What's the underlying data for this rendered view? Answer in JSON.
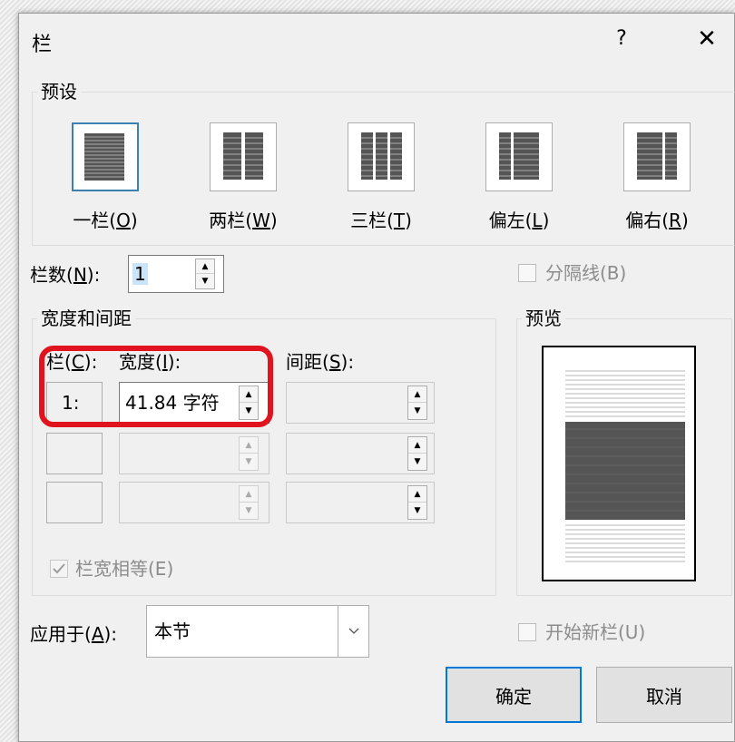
{
  "dialog": {
    "title": "栏",
    "help_label": "?",
    "close_label": "✕"
  },
  "presets": {
    "group_label": "预设",
    "items": [
      {
        "text": "一栏(",
        "key": "O",
        "end": ")",
        "icon": "one-column-icon"
      },
      {
        "text": "两栏(",
        "key": "W",
        "end": ")",
        "icon": "two-columns-icon"
      },
      {
        "text": "三栏(",
        "key": "T",
        "end": ")",
        "icon": "three-columns-icon"
      },
      {
        "text": "偏左(",
        "key": "L",
        "end": ")",
        "icon": "left-column-icon"
      },
      {
        "text": "偏右(",
        "key": "R",
        "end": ")",
        "icon": "right-column-icon"
      }
    ],
    "selected_index": 0
  },
  "column_count": {
    "label_text": "栏数(",
    "label_key": "N",
    "label_end": "):",
    "value": "1"
  },
  "separator": {
    "label": "分隔线(B)",
    "checked": false
  },
  "width_spacing": {
    "group_label": "宽度和间距",
    "col_header_text": "栏(",
    "col_header_key": "C",
    "col_header_end": "):",
    "width_header_text": "宽度(",
    "width_header_key": "I",
    "width_header_end": "):",
    "spacing_header_text": "间距(",
    "spacing_header_key": "S",
    "spacing_header_end": "):",
    "rows": [
      {
        "col": "1:",
        "width": "41.84 字符",
        "spacing": ""
      },
      {
        "col": "",
        "width": "",
        "spacing": ""
      },
      {
        "col": "",
        "width": "",
        "spacing": ""
      }
    ],
    "equal_width_label": "栏宽相等(E)",
    "equal_width_checked": true
  },
  "preview": {
    "group_label": "预览"
  },
  "apply_to": {
    "label_text": "应用于(",
    "label_key": "A",
    "label_end": "):",
    "value": "本节"
  },
  "new_column": {
    "label": "开始新栏(U)",
    "checked": false
  },
  "buttons": {
    "ok": "确定",
    "cancel": "取消"
  },
  "spinner": {
    "up": "▲",
    "down": "▼"
  },
  "colors": {
    "highlight": "#e0141e",
    "default_button": "#0078d7",
    "selected_preset": "#3c7fb1"
  }
}
